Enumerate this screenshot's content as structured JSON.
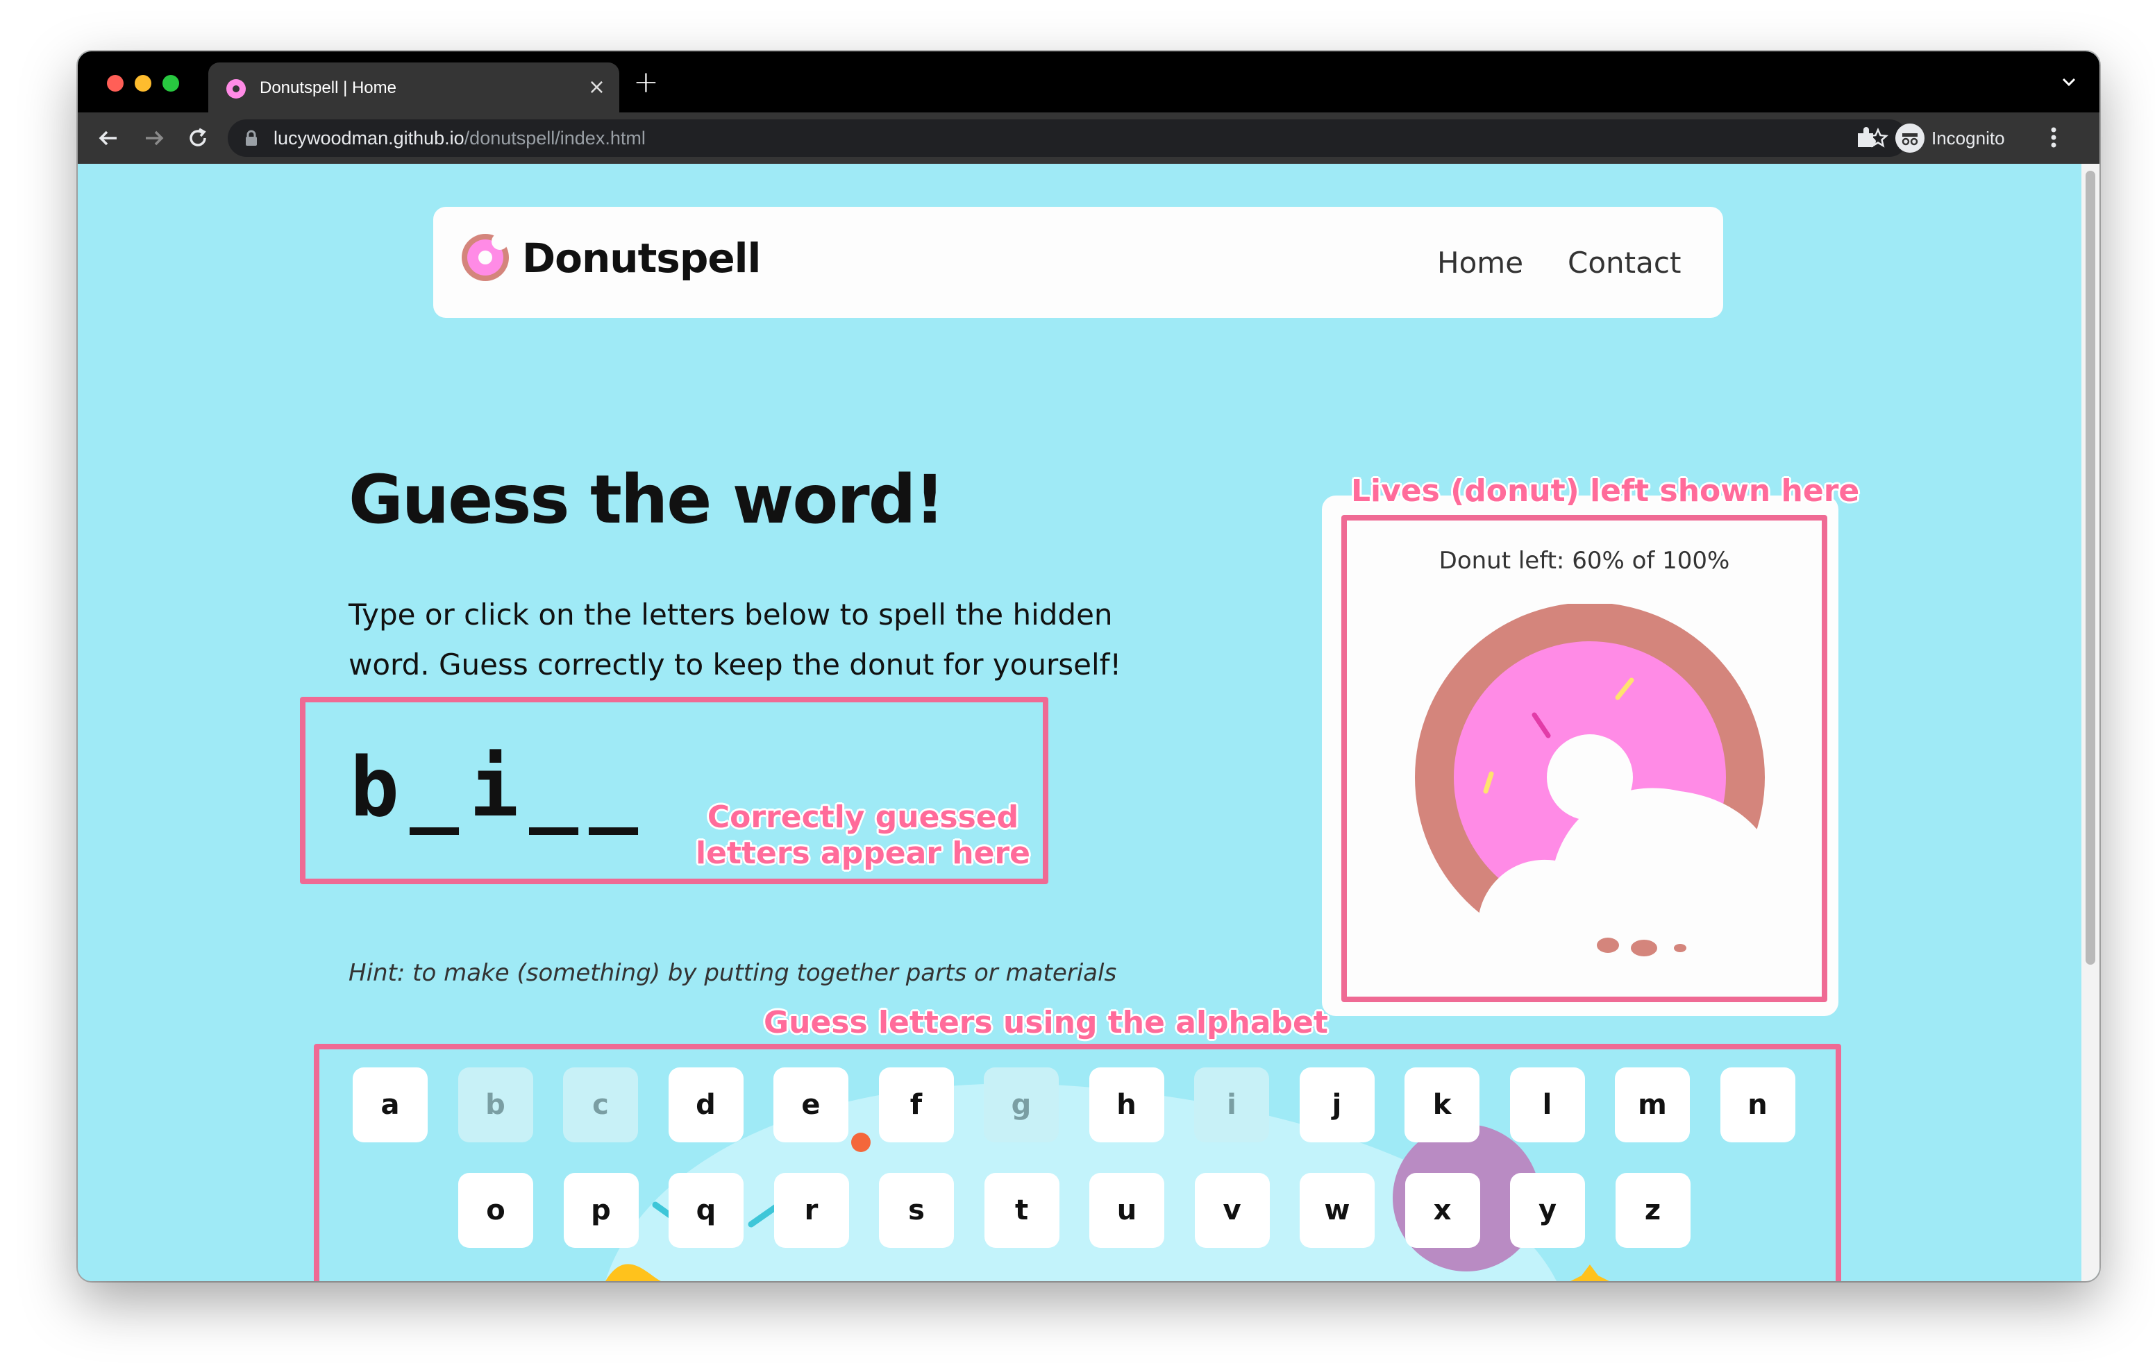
{
  "browser": {
    "tab_title": "Donutspell | Home",
    "url_host": "lucywoodman.github.io",
    "url_path": "/donutspell/index.html",
    "profile_label": "Incognito"
  },
  "navbar": {
    "logo_text": "Donutspell",
    "links": [
      "Home",
      "Contact"
    ]
  },
  "game": {
    "title": "Guess the word!",
    "description": "Type or click on the letters below to spell the hidden word. Guess correctly to keep the donut for yourself!",
    "word_letters": [
      "b",
      "_",
      "i",
      "_",
      "_"
    ],
    "hint": "Hint: to make (something) by putting together parts or materials",
    "donut_label": "Donut left: 60% of 100%",
    "donut_left_fraction": 0.6
  },
  "annotations": {
    "word_line1": "Correctly guessed",
    "word_line2": "letters appear here",
    "lives": "Lives (donut) left shown here",
    "alphabet": "Guess letters using the alphabet"
  },
  "keyboard": {
    "row1": [
      {
        "letter": "a",
        "used": false
      },
      {
        "letter": "b",
        "used": true
      },
      {
        "letter": "c",
        "used": true
      },
      {
        "letter": "d",
        "used": false
      },
      {
        "letter": "e",
        "used": false
      },
      {
        "letter": "f",
        "used": false
      },
      {
        "letter": "g",
        "used": true
      },
      {
        "letter": "h",
        "used": false
      },
      {
        "letter": "i",
        "used": true
      },
      {
        "letter": "j",
        "used": false
      },
      {
        "letter": "k",
        "used": false
      },
      {
        "letter": "l",
        "used": false
      },
      {
        "letter": "m",
        "used": false
      },
      {
        "letter": "n",
        "used": false
      }
    ],
    "row2": [
      {
        "letter": "o",
        "used": false
      },
      {
        "letter": "p",
        "used": false
      },
      {
        "letter": "q",
        "used": false
      },
      {
        "letter": "r",
        "used": false
      },
      {
        "letter": "s",
        "used": false
      },
      {
        "letter": "t",
        "used": false
      },
      {
        "letter": "u",
        "used": false
      },
      {
        "letter": "v",
        "used": false
      },
      {
        "letter": "w",
        "used": false
      },
      {
        "letter": "x",
        "used": false
      },
      {
        "letter": "y",
        "used": false
      },
      {
        "letter": "z",
        "used": false
      }
    ]
  },
  "colors": {
    "page_bg": "#9feaf6",
    "annotation_pink": "#ef6a94",
    "donut_dough": "#d4857c",
    "donut_icing": "#ff8be6"
  }
}
